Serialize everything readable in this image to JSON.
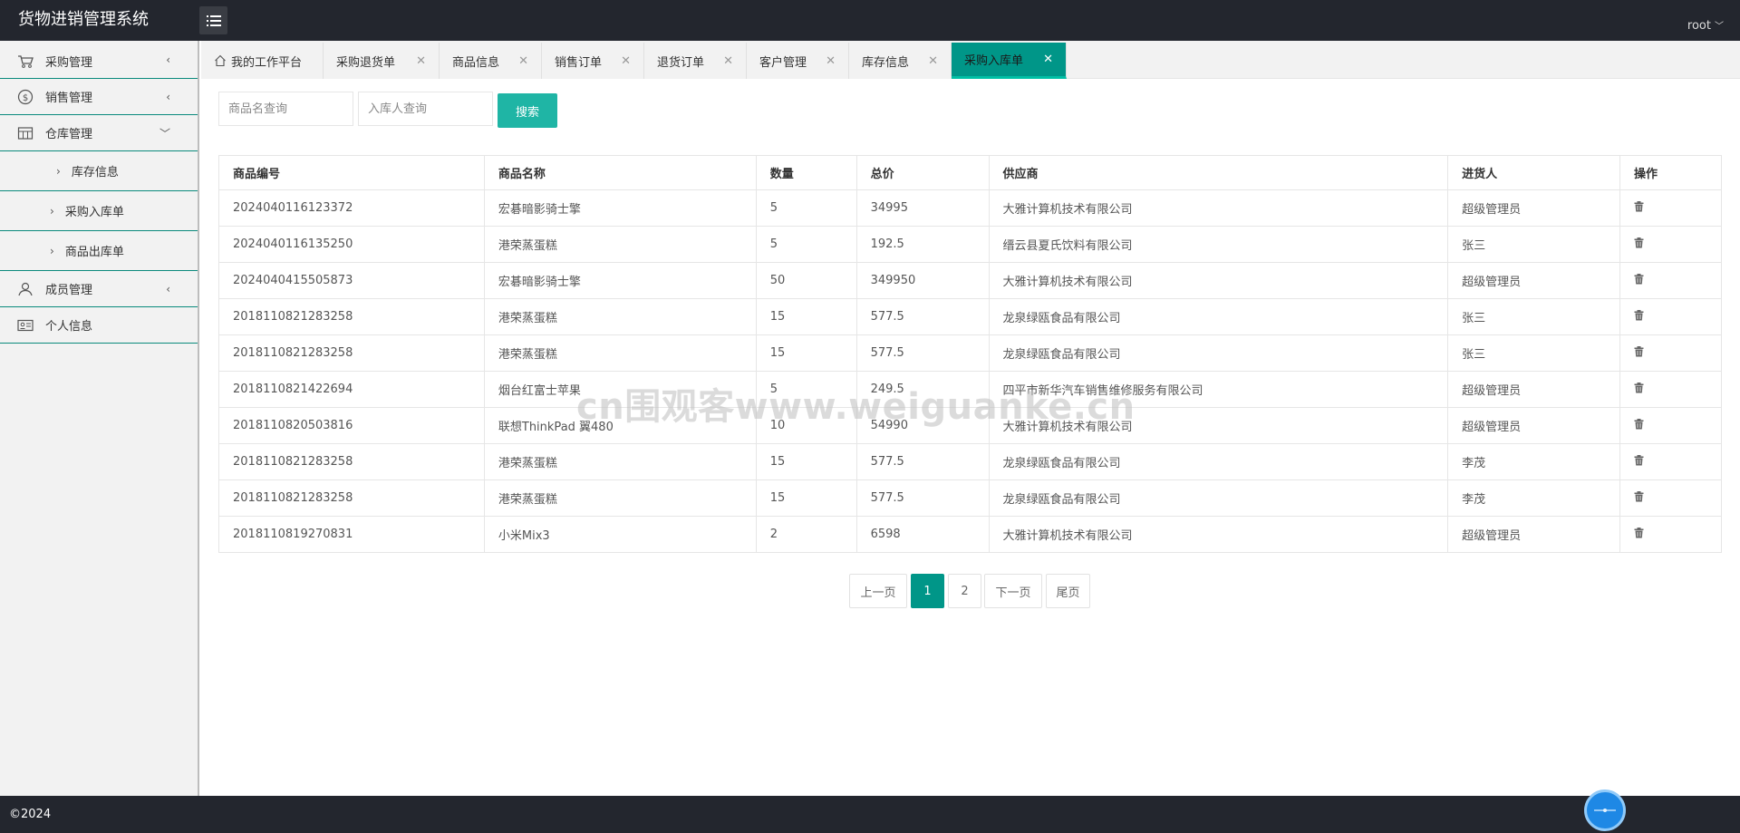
{
  "header": {
    "app_title": "货物进销管理系统",
    "user": "root"
  },
  "sidebar": {
    "items": [
      {
        "label": "采购管理",
        "icon": "cart-icon"
      },
      {
        "label": "销售管理",
        "icon": "dollar-icon"
      },
      {
        "label": "仓库管理",
        "icon": "warehouse-icon"
      },
      {
        "label": "成员管理",
        "icon": "user-icon"
      },
      {
        "label": "个人信息",
        "icon": "id-card-icon"
      }
    ],
    "warehouse_sub": [
      "库存信息",
      "采购入库单",
      "商品出库单"
    ]
  },
  "tabs": [
    "我的工作平台",
    "采购退货单",
    "商品信息",
    "销售订单",
    "退货订单",
    "客户管理",
    "库存信息",
    "采购入库单"
  ],
  "search": {
    "product_placeholder": "商品名查询",
    "stocker_placeholder": "入库人查询",
    "button": "搜索"
  },
  "table": {
    "headers": [
      "商品编号",
      "商品名称",
      "数量",
      "总价",
      "供应商",
      "进货人",
      "操作"
    ],
    "rows": [
      [
        "2024040116123372",
        "宏碁暗影骑士擎",
        "5",
        "34995",
        "大雅计算机技术有限公司",
        "超级管理员"
      ],
      [
        "2024040116135250",
        "港荣蒸蛋糕",
        "5",
        "192.5",
        "缙云县夏氏饮料有限公司",
        "张三"
      ],
      [
        "2024040415505873",
        "宏碁暗影骑士擎",
        "50",
        "349950",
        "大雅计算机技术有限公司",
        "超级管理员"
      ],
      [
        "2018110821283258",
        "港荣蒸蛋糕",
        "15",
        "577.5",
        "龙泉绿瓯食品有限公司",
        "张三"
      ],
      [
        "2018110821283258",
        "港荣蒸蛋糕",
        "15",
        "577.5",
        "龙泉绿瓯食品有限公司",
        "张三"
      ],
      [
        "2018110821422694",
        "烟台红富士苹果",
        "5",
        "249.5",
        "四平市新华汽车销售维修服务有限公司",
        "超级管理员"
      ],
      [
        "2018110820503816",
        "联想ThinkPad 翼480",
        "10",
        "54990",
        "大雅计算机技术有限公司",
        "超级管理员"
      ],
      [
        "2018110821283258",
        "港荣蒸蛋糕",
        "15",
        "577.5",
        "龙泉绿瓯食品有限公司",
        "李茂"
      ],
      [
        "2018110821283258",
        "港荣蒸蛋糕",
        "15",
        "577.5",
        "龙泉绿瓯食品有限公司",
        "李茂"
      ],
      [
        "2018110819270831",
        "小米Mix3",
        "2",
        "6598",
        "大雅计算机技术有限公司",
        "超级管理员"
      ]
    ]
  },
  "pagination": {
    "prev": "上一页",
    "pages": [
      "1",
      "2"
    ],
    "current": "1",
    "next": "下一页",
    "last": "尾页"
  },
  "watermark": "cn围观客www.weiguanke.cn",
  "footer": {
    "copyright": "©2024"
  },
  "colors": {
    "header_bg": "#23262e",
    "accent": "#009688",
    "search_button": "#1fb5a5"
  }
}
